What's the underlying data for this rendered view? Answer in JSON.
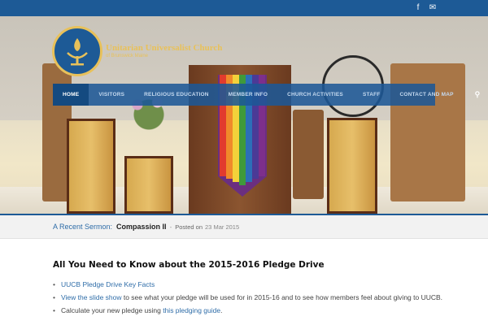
{
  "header": {
    "social": [
      {
        "icon": "facebook-icon",
        "glyph": "f"
      },
      {
        "icon": "email-icon",
        "glyph": "✉"
      }
    ]
  },
  "logo": {
    "line1": "Unitarian Universalist Church",
    "line2": "of Brunswick Maine"
  },
  "nav": {
    "items": [
      "HOME",
      "VISITORS",
      "RELIGIOUS EDUCATION",
      "MEMBER INFO",
      "CHURCH ACTIVITIES",
      "STAFF",
      "CONTACT AND MAP"
    ],
    "search_glyph": "⚲"
  },
  "sermon": {
    "label": "A Recent Sermon:",
    "title": "Compassion II",
    "separator": "-",
    "posted_label": "Posted on",
    "date": "23 Mar 2015"
  },
  "main": {
    "heading": "All You Need to Know about the 2015-2016 Pledge Drive",
    "bullets": [
      {
        "link": "UUCB Pledge Drive Key Facts",
        "text": ""
      },
      {
        "link": "View the slide show",
        "text": " to see what your pledge will be used for in 2015-16 and to see how members feel about giving to UUCB."
      },
      {
        "pre": "Calculate your new pledge using ",
        "link": "this pledging guide",
        "post": "."
      }
    ]
  },
  "colors": {
    "brand_blue": "#1d5a96",
    "gold": "#e8c15a",
    "link": "#2f6da8"
  }
}
